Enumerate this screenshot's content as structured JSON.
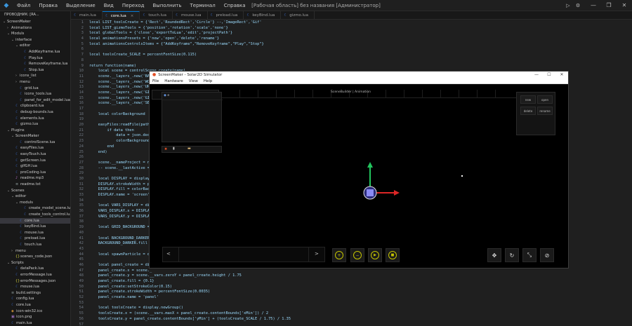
{
  "titlebar": {
    "menu": [
      "Файл",
      "Правка",
      "Выделение",
      "Вид",
      "Переход",
      "Выполнить",
      "Терминал",
      "Справка"
    ],
    "window_title": "[Рабочая область] без названия [Администратор]",
    "run_icons": [
      "play-icon",
      "debug-icon"
    ],
    "window_controls": [
      "—",
      "❐",
      "✕"
    ]
  },
  "sidebar": {
    "header": "ПРОВОДНИК: [RA...",
    "items": [
      {
        "label": "ScreenMaker",
        "depth": 0,
        "type": "folder",
        "open": true
      },
      {
        "label": "Animations",
        "depth": 1,
        "type": "folder",
        "open": false
      },
      {
        "label": "Moduls",
        "depth": 1,
        "type": "folder",
        "open": true
      },
      {
        "label": "interface",
        "depth": 2,
        "type": "folder",
        "open": true
      },
      {
        "label": "editor",
        "depth": 3,
        "type": "folder",
        "open": true
      },
      {
        "label": "AddKeyframe.lua",
        "depth": 4,
        "type": "lua"
      },
      {
        "label": "Play.lua",
        "depth": 4,
        "type": "lua"
      },
      {
        "label": "RemoveKeyframe.lua",
        "depth": 4,
        "type": "lua"
      },
      {
        "label": "Stop.lua",
        "depth": 4,
        "type": "lua"
      },
      {
        "label": "icons_list",
        "depth": 3,
        "type": "folder",
        "open": false
      },
      {
        "label": "menu",
        "depth": 3,
        "type": "folder",
        "open": false
      },
      {
        "label": "grid.lua",
        "depth": 3,
        "type": "lua"
      },
      {
        "label": "icons_tools.lua",
        "depth": 3,
        "type": "lua"
      },
      {
        "label": "panel_for_edit_model.lua",
        "depth": 3,
        "type": "lua"
      },
      {
        "label": "clipboard.lua",
        "depth": 2,
        "type": "lua"
      },
      {
        "label": "debug-bounds.lua",
        "depth": 2,
        "type": "lua"
      },
      {
        "label": "elements.lua",
        "depth": 2,
        "type": "lua"
      },
      {
        "label": "gizmo.lua",
        "depth": 2,
        "type": "lua"
      },
      {
        "label": "Plugins",
        "depth": 1,
        "type": "folder",
        "open": true
      },
      {
        "label": "ScreenMaker",
        "depth": 2,
        "type": "folder",
        "open": true
      },
      {
        "label": "controlScene.lua",
        "depth": 3,
        "type": "lua"
      },
      {
        "label": "easyFiles.lua",
        "depth": 2,
        "type": "lua"
      },
      {
        "label": "easyTouch.lua",
        "depth": 2,
        "type": "lua"
      },
      {
        "label": "getScreen.lua",
        "depth": 2,
        "type": "lua"
      },
      {
        "label": "glfGH.lua",
        "depth": 2,
        "type": "lua"
      },
      {
        "label": "proCoding.lua",
        "depth": 2,
        "type": "lua"
      },
      {
        "label": "readme.mp3",
        "depth": 2,
        "type": "mp3"
      },
      {
        "label": "readme.txt",
        "depth": 2,
        "type": "txt"
      },
      {
        "label": "Scenes",
        "depth": 1,
        "type": "folder",
        "open": true
      },
      {
        "label": "editor",
        "depth": 2,
        "type": "folder",
        "open": true
      },
      {
        "label": "moduls",
        "depth": 3,
        "type": "folder",
        "open": true
      },
      {
        "label": "create_model_scene.lua",
        "depth": 4,
        "type": "lua"
      },
      {
        "label": "create_tools_control.lua",
        "depth": 4,
        "type": "lua"
      },
      {
        "label": "core.lua",
        "depth": 3,
        "type": "lua",
        "selected": true
      },
      {
        "label": "keyBind.lua",
        "depth": 3,
        "type": "lua"
      },
      {
        "label": "mouse.lua",
        "depth": 3,
        "type": "lua"
      },
      {
        "label": "preload.lua",
        "depth": 3,
        "type": "lua"
      },
      {
        "label": "touch.lua",
        "depth": 3,
        "type": "lua"
      },
      {
        "label": "menu",
        "depth": 2,
        "type": "folder",
        "open": false
      },
      {
        "label": "scenes_code.json",
        "depth": 2,
        "type": "json"
      },
      {
        "label": "Scripts",
        "depth": 1,
        "type": "folder",
        "open": true
      },
      {
        "label": "dataPack.lua",
        "depth": 2,
        "type": "lua"
      },
      {
        "label": "errorMessage.lua",
        "depth": 2,
        "type": "lua"
      },
      {
        "label": "errorMessages.json",
        "depth": 2,
        "type": "json"
      },
      {
        "label": "mouse.lua",
        "depth": 2,
        "type": "lua"
      },
      {
        "label": "build.settings",
        "depth": 1,
        "type": "txt"
      },
      {
        "label": "config.lua",
        "depth": 1,
        "type": "lua"
      },
      {
        "label": "core.lua",
        "depth": 1,
        "type": "lua"
      },
      {
        "label": "icon-win32.ico",
        "depth": 1,
        "type": "ico"
      },
      {
        "label": "icon.png",
        "depth": 1,
        "type": "png"
      },
      {
        "label": "main.lua",
        "depth": 1,
        "type": "lua"
      }
    ]
  },
  "tabs": [
    {
      "label": "main.lua",
      "active": false
    },
    {
      "label": "core.lua",
      "active": true
    },
    {
      "label": "touch.lua",
      "active": false
    },
    {
      "label": "mouse.lua",
      "active": false
    },
    {
      "label": "preload.lua",
      "active": false
    },
    {
      "label": "keyBind.lua",
      "active": false
    },
    {
      "label": "gizmo.lua",
      "active": false
    }
  ],
  "editor": {
    "lines": [
      {
        "n": "1",
        "text": "local LIST_toolsCreate = {'Rect','RoundedRect','Circle'} --,'ImageRect','Gif'"
      },
      {
        "n": "2",
        "text": "local LIST_gizmoTools = {'position','rotation','scale','none'}"
      },
      {
        "n": "3",
        "text": "local globalTools = {'close','exportToLua','edit','projectPath'}"
      },
      {
        "n": "4",
        "text": "local animationsPresets = {'new','open','delete','rename'}"
      },
      {
        "n": "5",
        "text": "local animationsControlsItems = {\"AddKeyframe\",\"RemoveKeyframe\",\"Play\",\"Stop\"}"
      },
      {
        "n": "6",
        "text": ""
      },
      {
        "n": "7",
        "text": "local toolsCreate_SCALE = percentFontSize(0.115)"
      },
      {
        "n": "8",
        "text": ""
      },
      {
        "n": "9",
        "text": "return function(name)"
      },
      {
        "n": "10",
        "text": "    local scene = controlScene.create(name)"
      },
      {
        "n": "11",
        "text": "    scene.__layers_.new('BAC"
      },
      {
        "n": "12",
        "text": "    scene.__layers_.new('WOR"
      },
      {
        "n": "13",
        "text": "    scene.__layers_.new('UPG"
      },
      {
        "n": "14",
        "text": "    scene.__layers_.new('GIZ"
      },
      {
        "n": "15",
        "text": "    scene.__layers_.new('GIZ"
      },
      {
        "n": "16",
        "text": "    scene.__layers_.new('SE"
      },
      {
        "n": "17",
        "text": ""
      },
      {
        "n": "18",
        "text": "    local colorBackground"
      },
      {
        "n": "19",
        "text": ""
      },
      {
        "n": "20",
        "text": "    easyFiles:readFile(path"
      },
      {
        "n": "21",
        "text": "        if data then"
      },
      {
        "n": "22",
        "text": "            data = json.dec"
      },
      {
        "n": "23",
        "text": "            colorBackground"
      },
      {
        "n": "24",
        "text": "        end"
      },
      {
        "n": "25",
        "text": "    end)"
      },
      {
        "n": "26",
        "text": ""
      },
      {
        "n": "27",
        "text": "    scene.__nameProject = na"
      },
      {
        "n": "28",
        "text": "    -- scene.__lastActive ="
      },
      {
        "n": "29",
        "text": ""
      },
      {
        "n": "30",
        "text": "    local DISPLAY = display."
      },
      {
        "n": "31",
        "text": "    DISPLAY.strokeWidth = p"
      },
      {
        "n": "32",
        "text": "    DISPLAY.fill = colorBac"
      },
      {
        "n": "33",
        "text": "    DISPLAY.name = 'screen'"
      },
      {
        "n": "34",
        "text": ""
      },
      {
        "n": "35",
        "text": "    local VARS_DISPLAY = dis"
      },
      {
        "n": "36",
        "text": "    VARS_DISPLAY.x = DISPLAY"
      },
      {
        "n": "37",
        "text": "    VARS_DISPLAY.y = DISPLAY"
      },
      {
        "n": "38",
        "text": ""
      },
      {
        "n": "39",
        "text": "    local GRID_BACKGROUND ="
      },
      {
        "n": "40",
        "text": ""
      },
      {
        "n": "41",
        "text": "    local BACKGROUND_DARKER"
      },
      {
        "n": "42",
        "text": "    BACKGROUND_DARKER.fill ="
      },
      {
        "n": "43",
        "text": ""
      },
      {
        "n": "44",
        "text": "    local spawnParticle = di"
      },
      {
        "n": "45",
        "text": ""
      },
      {
        "n": "46",
        "text": "    local panel_create = dis"
      },
      {
        "n": "47",
        "text": "    panel_create.x = scene._"
      },
      {
        "n": "48",
        "text": "    panel_create.y = scene.__vars.zeroY + panel_create.height / 1.75"
      },
      {
        "n": "49",
        "text": "    panel_create.fill = {0.1}"
      },
      {
        "n": "50",
        "text": "    panel_create:setStrokeColor(0.15)"
      },
      {
        "n": "51",
        "text": "    panel_create.strokeWidth = percentFontSize(0.0035)"
      },
      {
        "n": "52",
        "text": "    panel_create.name = 'panel'"
      },
      {
        "n": "53",
        "text": ""
      },
      {
        "n": "54",
        "text": "    local toolsCreate = display.newGroup()"
      },
      {
        "n": "55",
        "text": "    toolsCreate.x = (scene.__vars.maxX + panel_create.contentBounds['xMin']) / 2"
      },
      {
        "n": "56",
        "text": "    toolsCreate.y = panel_create.contentBounds['yMin'] + (toolsCreate_SCALE / 1.75) / 1.35"
      },
      {
        "n": "57",
        "text": ""
      },
      {
        "n": "58",
        "text": "    local panel_createY = 0"
      }
    ]
  },
  "simulator": {
    "title": "ScreenMaker - Solar2D Simulator",
    "window_controls": [
      "—",
      "☐",
      "✕"
    ],
    "menu": [
      "File",
      "Hardware",
      "View",
      "Help"
    ],
    "stage_title": "SceneBuilder | Animation",
    "left_panel_item": "e",
    "right_panel_buttons": [
      "new",
      "open",
      "delete",
      "rename"
    ],
    "prev_arrow": "<",
    "next_arrow": ">",
    "anim_controls": [
      "add-keyframe-icon",
      "remove-keyframe-icon",
      "play-icon",
      "stop-icon"
    ],
    "gizmo_tools": [
      "move-icon",
      "rotate-icon",
      "scale-icon",
      "none-icon"
    ],
    "colors": {
      "accent_green": "#c4c400",
      "gizmo_y": "#22c55e",
      "gizmo_x": "#dc2626",
      "gizmo_center": "#6d6df2"
    }
  }
}
